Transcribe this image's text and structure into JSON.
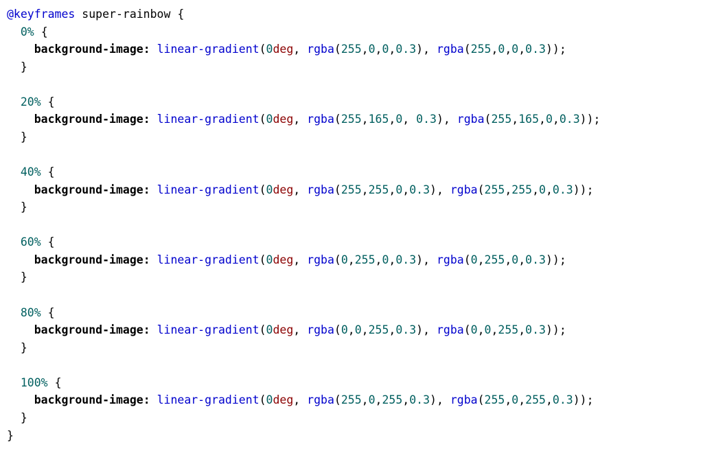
{
  "keyframes_name": "super-rainbow",
  "property": "background-image",
  "function": "linear-gradient",
  "angle": {
    "value": "0",
    "unit": "deg"
  },
  "stops": [
    {
      "pct": "0%",
      "c1": "rgba(255,0,0,0.3)",
      "c2": "rgba(255,0,0,0.3)"
    },
    {
      "pct": "20%",
      "c1": "rgba(255,165,0, 0.3)",
      "c2": "rgba(255,165,0,0.3)"
    },
    {
      "pct": "40%",
      "c1": "rgba(255,255,0,0.3)",
      "c2": "rgba(255,255,0,0.3)"
    },
    {
      "pct": "60%",
      "c1": "rgba(0,255,0,0.3)",
      "c2": "rgba(0,255,0,0.3)"
    },
    {
      "pct": "80%",
      "c1": "rgba(0,0,255,0.3)",
      "c2": "rgba(0,0,255,0.3)"
    },
    {
      "pct": "100%",
      "c1": "rgba(255,0,255,0.3)",
      "c2": "rgba(255,0,255,0.3)"
    }
  ]
}
